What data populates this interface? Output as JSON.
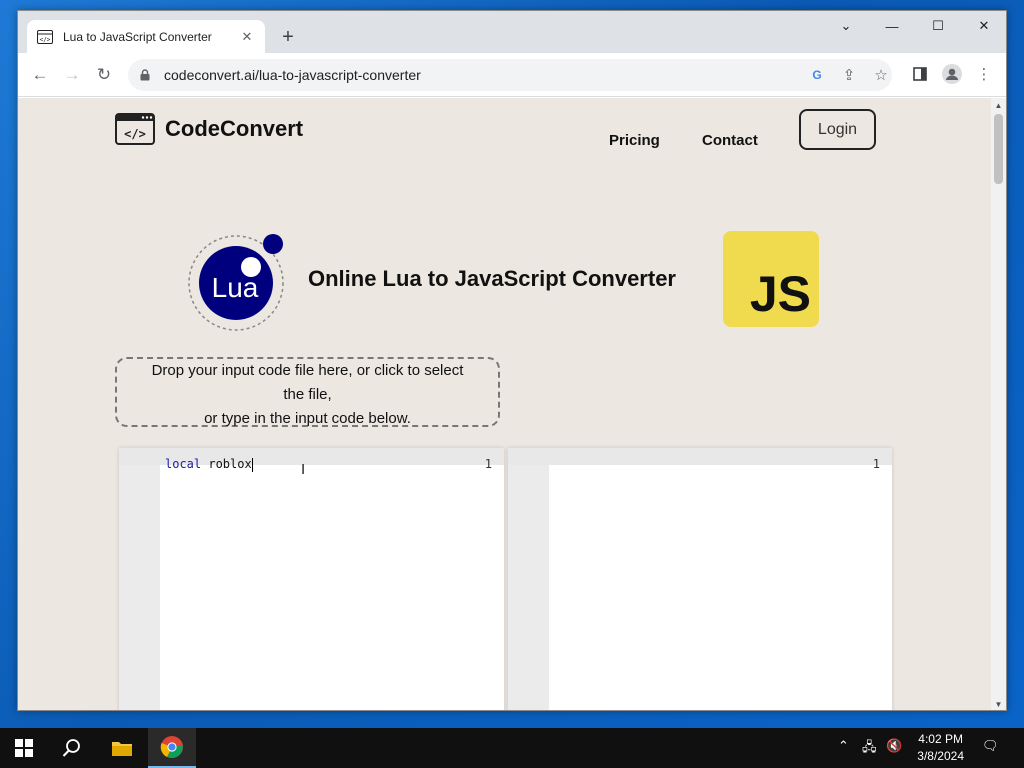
{
  "browser": {
    "tab_title": "Lua to JavaScript Converter",
    "url": "codeconvert.ai/lua-to-javascript-converter",
    "window_controls": [
      "minimize-icon",
      "maximize-icon",
      "close-icon"
    ]
  },
  "site": {
    "brand_name": "CodeConvert",
    "nav": {
      "pricing": "Pricing",
      "contact": "Contact",
      "login": "Login"
    },
    "headline": "Online Lua to JavaScript Converter",
    "lua_logo_text": "Lua",
    "js_logo_text": "JS",
    "dropzone": {
      "line1": "Drop your input code file here, or click to select",
      "line2": "the file,",
      "line3": "or type in the input code below."
    },
    "input_editor": {
      "line_number": "1",
      "keyword": "local",
      "text": " roblox"
    },
    "output_editor": {
      "line_number": "1"
    }
  },
  "taskbar": {
    "time": "4:02 PM",
    "date": "3/8/2024"
  },
  "colors": {
    "page_bg": "#ede7e2",
    "js_yellow": "#f0db4f",
    "lua_blue": "#00007e"
  }
}
